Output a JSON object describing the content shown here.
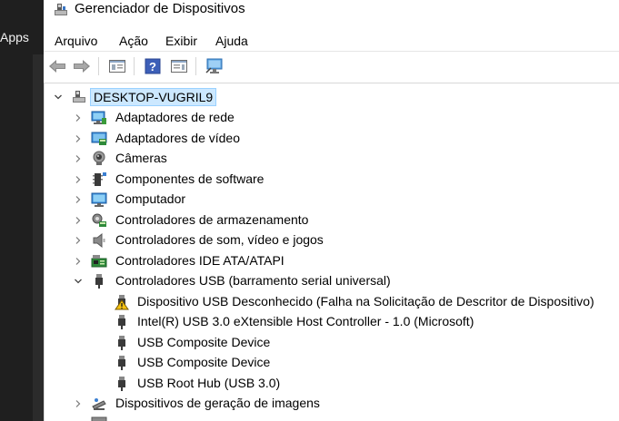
{
  "background_app": {
    "label": "Apps"
  },
  "window": {
    "title": "Gerenciador de Dispositivos",
    "menu": [
      "Arquivo",
      "Ação",
      "Exibir",
      "Ajuda"
    ],
    "toolbar_icons": [
      "back-arrow-icon",
      "forward-arrow-icon",
      "show-hide-console-tree-icon",
      "help-icon",
      "properties-pane-icon",
      "scan-hardware-icon"
    ]
  },
  "tree": {
    "root": {
      "label": "DESKTOP-VUGRIL9",
      "expanded": true
    },
    "categories": [
      {
        "label": "Adaptadores de rede",
        "icon": "network-adapter-icon",
        "expanded": false
      },
      {
        "label": "Adaptadores de vídeo",
        "icon": "display-adapter-icon",
        "expanded": false
      },
      {
        "label": "Câmeras",
        "icon": "camera-icon",
        "expanded": false
      },
      {
        "label": "Componentes de software",
        "icon": "software-component-icon",
        "expanded": false
      },
      {
        "label": "Computador",
        "icon": "computer-icon",
        "expanded": false
      },
      {
        "label": "Controladores de armazenamento",
        "icon": "storage-controller-icon",
        "expanded": false
      },
      {
        "label": "Controladores de som, vídeo e jogos",
        "icon": "speaker-icon",
        "expanded": false
      },
      {
        "label": "Controladores IDE ATA/ATAPI",
        "icon": "ide-controller-icon",
        "expanded": false
      },
      {
        "label": "Controladores USB (barramento serial universal)",
        "icon": "usb-plug-icon",
        "expanded": true
      }
    ],
    "usb_children": [
      {
        "label": "Dispositivo USB Desconhecido (Falha na Solicitação de Descritor de Dispositivo)",
        "icon": "warning-usb-icon"
      },
      {
        "label": "Intel(R) USB 3.0 eXtensible Host Controller - 1.0 (Microsoft)",
        "icon": "usb-plug-icon"
      },
      {
        "label": "USB Composite Device",
        "icon": "usb-plug-icon"
      },
      {
        "label": "USB Composite Device",
        "icon": "usb-plug-icon"
      },
      {
        "label": "USB Root Hub (USB 3.0)",
        "icon": "usb-plug-icon"
      }
    ],
    "after_usb": [
      {
        "label": "Dispositivos de geração de imagens",
        "icon": "imaging-device-icon",
        "expanded": false
      }
    ]
  },
  "colors": {
    "selection_bg": "#cce8ff",
    "selection_border": "#99d1ff",
    "warning": "#f5c211"
  }
}
